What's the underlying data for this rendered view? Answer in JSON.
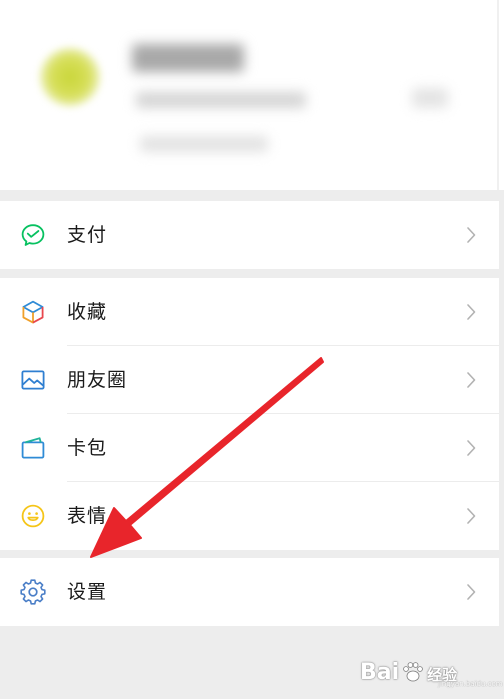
{
  "menu": {
    "pay": {
      "label": "支付",
      "icon": "wechat-pay-icon"
    },
    "favorites": {
      "label": "收藏",
      "icon": "cube-icon"
    },
    "moments": {
      "label": "朋友圈",
      "icon": "image-icon"
    },
    "cards": {
      "label": "卡包",
      "icon": "wallet-icon"
    },
    "stickers": {
      "label": "表情",
      "icon": "smiley-icon"
    },
    "settings": {
      "label": "设置",
      "icon": "gear-icon"
    }
  },
  "watermark": {
    "brand": "Bai",
    "sub": "经验",
    "url": "jingyan.baidu.com"
  },
  "colors": {
    "pay_green": "#07c160",
    "moments_blue": "#2f7fd1",
    "stickers_yellow": "#f5c518",
    "settings_blue": "#4a7ec7",
    "arrow_red": "#e8252b"
  }
}
